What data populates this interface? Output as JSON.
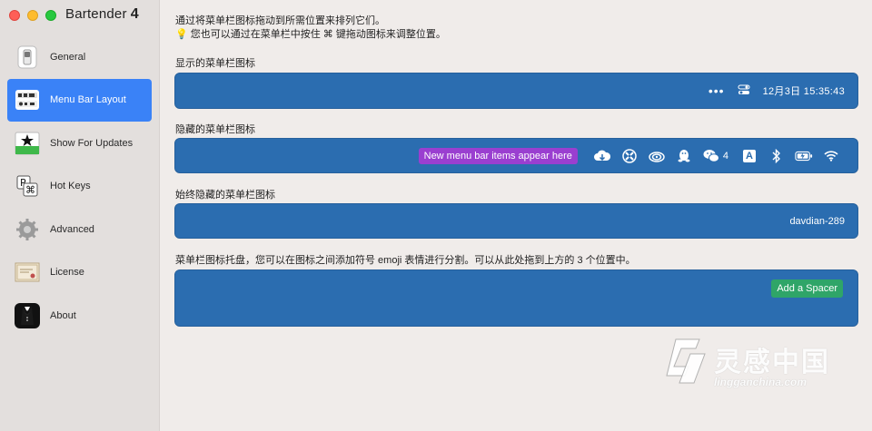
{
  "app": {
    "title": "Bartender",
    "version": "4"
  },
  "sidebar": {
    "items": [
      {
        "label": "General",
        "icon": "switch-icon"
      },
      {
        "label": "Menu Bar Layout",
        "icon": "menubar-layout-icon",
        "active": true
      },
      {
        "label": "Show For Updates",
        "icon": "star-icon"
      },
      {
        "label": "Hot Keys",
        "icon": "keyboard-keys-icon"
      },
      {
        "label": "Advanced",
        "icon": "gear-icon"
      },
      {
        "label": "License",
        "icon": "certificate-icon"
      },
      {
        "label": "About",
        "icon": "tuxedo-icon"
      }
    ]
  },
  "main": {
    "intro_line1": "通过将菜单栏图标拖动到所需位置来排列它们。",
    "intro_line2": "💡 您也可以通过在菜单栏中按住 ⌘ 键拖动图标来调整位置。",
    "shown": {
      "label": "显示的菜单栏图标",
      "items": [
        "•••",
        "12月3日  15:35:43"
      ]
    },
    "hidden": {
      "label": "隐藏的菜单栏图标",
      "new_items_text": "New menu bar items appear here",
      "icons": [
        "cloud-icon",
        "crossed-circle-icon",
        "creative-cloud-icon",
        "qq-penguin-icon",
        "wechat-icon",
        "input-method-icon",
        "bluetooth-icon",
        "battery-icon",
        "wifi-icon"
      ],
      "wechat_count": "4",
      "input_method": "A"
    },
    "always_hidden": {
      "label": "始终隐藏的菜单栏图标",
      "item": "davdian-289"
    },
    "tray": {
      "label": "菜单栏图标托盘，您可以在图标之间添加符号 emoji 表情进行分割。可以从此处拖到上方的 3 个位置中。",
      "button": "Add a Spacer"
    }
  },
  "watermark": {
    "text": "灵感中国",
    "url": "lingganchina.com"
  },
  "colors": {
    "bar": "#2b6db0",
    "sidebar_active": "#3a82f7",
    "new_items_badge": "#9a3fd0",
    "spacer_button": "#2fa568"
  }
}
